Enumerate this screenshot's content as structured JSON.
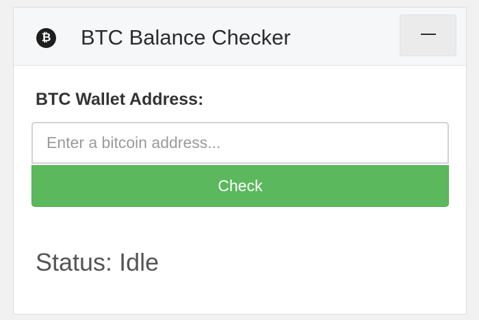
{
  "header": {
    "icon": "bitcoin-icon",
    "icon_glyph": "₿",
    "title": "BTC Balance Checker",
    "collapse_icon": "minus-icon"
  },
  "form": {
    "label": "BTC Wallet Address:",
    "input_value": "",
    "input_placeholder": "Enter a bitcoin address...",
    "button_label": "Check"
  },
  "status": {
    "text": "Status: Idle"
  },
  "colors": {
    "button_green": "#5cb85c",
    "header_background": "#f6f7f9",
    "page_background": "#f1f1f1"
  }
}
